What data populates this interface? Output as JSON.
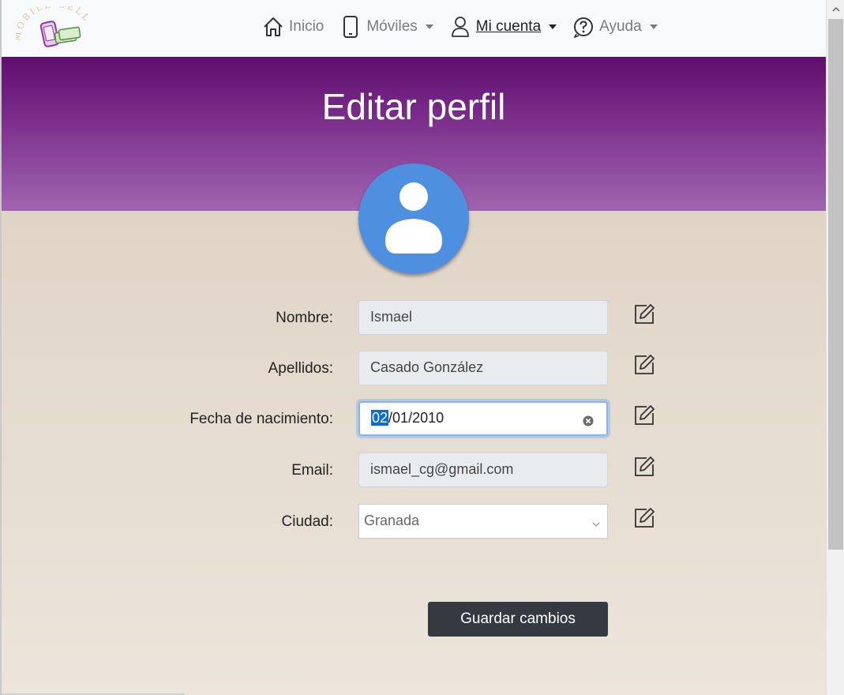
{
  "nav": {
    "logo_text": "MOBILE SELL",
    "items": [
      {
        "label": "Inicio",
        "icon": "house-icon",
        "dropdown": false
      },
      {
        "label": "Móviles",
        "icon": "smartphone-icon",
        "dropdown": true
      },
      {
        "label": "Mi cuenta",
        "icon": "person-icon",
        "dropdown": true,
        "active": true
      },
      {
        "label": "Ayuda",
        "icon": "question-circle-icon",
        "dropdown": true
      }
    ]
  },
  "page": {
    "title": "Editar perfil"
  },
  "form": {
    "nombre": {
      "label": "Nombre:",
      "value": "Ismael"
    },
    "apellidos": {
      "label": "Apellidos:",
      "value": "Casado González"
    },
    "fecha": {
      "label": "Fecha de nacimiento:",
      "day": "02",
      "sep1": "/",
      "month": "01",
      "sep2": "/",
      "year": "2010"
    },
    "email": {
      "label": "Email:",
      "value": "ismael_cg@gmail.com"
    },
    "ciudad": {
      "label": "Ciudad:",
      "value": "Granada"
    },
    "submit_label": "Guardar cambios"
  },
  "colors": {
    "hero_top": "#600d6e",
    "hero_bottom": "#a065b0",
    "avatar": "#4f8fe0",
    "button": "#343a40"
  }
}
